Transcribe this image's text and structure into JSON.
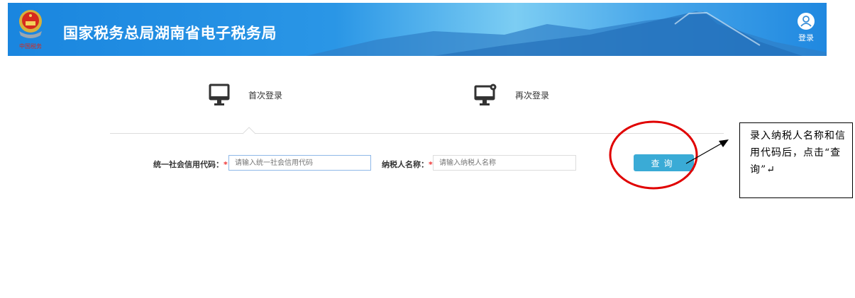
{
  "header": {
    "title": "国家税务总局湖南省电子税务局",
    "login_label": "登录",
    "emblem_text": "中国税务"
  },
  "tabs": [
    {
      "label": "首次登录"
    },
    {
      "label": "再次登录"
    }
  ],
  "form": {
    "credit_code_label": "统一社会信用代码：",
    "credit_code_placeholder": "请输入统一社会信用代码",
    "credit_code_value": "",
    "name_label": "纳税人名称：",
    "name_placeholder": "请输入纳税人名称",
    "name_value": "",
    "required_mark": "*",
    "query_button": "查询"
  },
  "annotation": {
    "text": "录入纳税人名称和信用代码后，点击“查询”↵"
  },
  "colors": {
    "header": "#1a86df",
    "button": "#3aabd6",
    "highlight": "#e00000"
  }
}
